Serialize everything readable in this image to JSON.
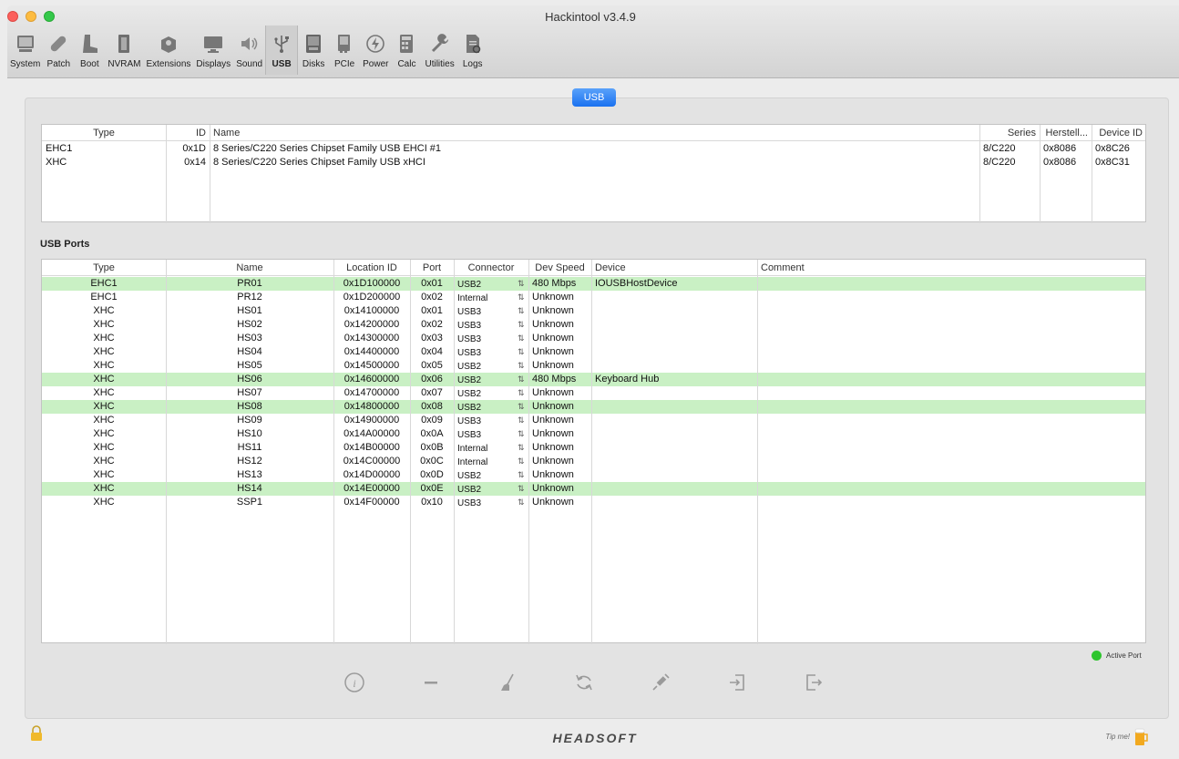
{
  "window": {
    "title": "Hackintool v3.4.9"
  },
  "toolbar": [
    {
      "label": "System",
      "icon": "system-icon"
    },
    {
      "label": "Patch",
      "icon": "patch-icon"
    },
    {
      "label": "Boot",
      "icon": "boot-icon"
    },
    {
      "label": "NVRAM",
      "icon": "nvram-icon"
    },
    {
      "label": "Extensions",
      "icon": "extensions-icon"
    },
    {
      "label": "Displays",
      "icon": "displays-icon"
    },
    {
      "label": "Sound",
      "icon": "sound-icon"
    },
    {
      "label": "USB",
      "icon": "usb-icon",
      "active": true
    },
    {
      "label": "Disks",
      "icon": "disks-icon"
    },
    {
      "label": "PCIe",
      "icon": "pcie-icon"
    },
    {
      "label": "Power",
      "icon": "power-icon"
    },
    {
      "label": "Calc",
      "icon": "calc-icon"
    },
    {
      "label": "Utilities",
      "icon": "utilities-icon"
    },
    {
      "label": "Logs",
      "icon": "logs-icon"
    }
  ],
  "tab": {
    "label": "USB"
  },
  "controllers": {
    "headers": {
      "type": "Type",
      "id": "ID",
      "name": "Name",
      "series": "Series",
      "vendor": "Herstell...",
      "device": "Device ID"
    },
    "rows": [
      {
        "type": "EHC1",
        "id": "0x1D",
        "name": "8 Series/C220 Series Chipset Family USB EHCI #1",
        "series": "8/C220",
        "vendor": "0x8086",
        "device": "0x8C26"
      },
      {
        "type": "XHC",
        "id": "0x14",
        "name": "8 Series/C220 Series Chipset Family USB xHCI",
        "series": "8/C220",
        "vendor": "0x8086",
        "device": "0x8C31"
      }
    ]
  },
  "ports": {
    "title": "USB Ports",
    "headers": {
      "type": "Type",
      "name": "Name",
      "location": "Location ID",
      "port": "Port",
      "connector": "Connector",
      "speed": "Dev Speed",
      "device": "Device",
      "comment": "Comment"
    },
    "rows": [
      {
        "type": "EHC1",
        "name": "PR01",
        "location": "0x1D100000",
        "port": "0x01",
        "connector": "USB2",
        "speed": "480 Mbps",
        "device": "IOUSBHostDevice",
        "comment": "",
        "active": true
      },
      {
        "type": "EHC1",
        "name": "PR12",
        "location": "0x1D200000",
        "port": "0x02",
        "connector": "Internal",
        "speed": "Unknown",
        "device": "",
        "comment": "",
        "active": false
      },
      {
        "type": "XHC",
        "name": "HS01",
        "location": "0x14100000",
        "port": "0x01",
        "connector": "USB3",
        "speed": "Unknown",
        "device": "",
        "comment": "",
        "active": false
      },
      {
        "type": "XHC",
        "name": "HS02",
        "location": "0x14200000",
        "port": "0x02",
        "connector": "USB3",
        "speed": "Unknown",
        "device": "",
        "comment": "",
        "active": false
      },
      {
        "type": "XHC",
        "name": "HS03",
        "location": "0x14300000",
        "port": "0x03",
        "connector": "USB3",
        "speed": "Unknown",
        "device": "",
        "comment": "",
        "active": false
      },
      {
        "type": "XHC",
        "name": "HS04",
        "location": "0x14400000",
        "port": "0x04",
        "connector": "USB3",
        "speed": "Unknown",
        "device": "",
        "comment": "",
        "active": false
      },
      {
        "type": "XHC",
        "name": "HS05",
        "location": "0x14500000",
        "port": "0x05",
        "connector": "USB2",
        "speed": "Unknown",
        "device": "",
        "comment": "",
        "active": false
      },
      {
        "type": "XHC",
        "name": "HS06",
        "location": "0x14600000",
        "port": "0x06",
        "connector": "USB2",
        "speed": "480 Mbps",
        "device": "Keyboard Hub",
        "comment": "",
        "active": true
      },
      {
        "type": "XHC",
        "name": "HS07",
        "location": "0x14700000",
        "port": "0x07",
        "connector": "USB2",
        "speed": "Unknown",
        "device": "",
        "comment": "",
        "active": false
      },
      {
        "type": "XHC",
        "name": "HS08",
        "location": "0x14800000",
        "port": "0x08",
        "connector": "USB2",
        "speed": "Unknown",
        "device": "",
        "comment": "",
        "active": true
      },
      {
        "type": "XHC",
        "name": "HS09",
        "location": "0x14900000",
        "port": "0x09",
        "connector": "USB3",
        "speed": "Unknown",
        "device": "",
        "comment": "",
        "active": false
      },
      {
        "type": "XHC",
        "name": "HS10",
        "location": "0x14A00000",
        "port": "0x0A",
        "connector": "USB3",
        "speed": "Unknown",
        "device": "",
        "comment": "",
        "active": false
      },
      {
        "type": "XHC",
        "name": "HS11",
        "location": "0x14B00000",
        "port": "0x0B",
        "connector": "Internal",
        "speed": "Unknown",
        "device": "",
        "comment": "",
        "active": false
      },
      {
        "type": "XHC",
        "name": "HS12",
        "location": "0x14C00000",
        "port": "0x0C",
        "connector": "Internal",
        "speed": "Unknown",
        "device": "",
        "comment": "",
        "active": false
      },
      {
        "type": "XHC",
        "name": "HS13",
        "location": "0x14D00000",
        "port": "0x0D",
        "connector": "USB2",
        "speed": "Unknown",
        "device": "",
        "comment": "",
        "active": false
      },
      {
        "type": "XHC",
        "name": "HS14",
        "location": "0x14E00000",
        "port": "0x0E",
        "connector": "USB2",
        "speed": "Unknown",
        "device": "",
        "comment": "",
        "active": true
      },
      {
        "type": "XHC",
        "name": "SSP1",
        "location": "0x14F00000",
        "port": "0x10",
        "connector": "USB3",
        "speed": "Unknown",
        "device": "",
        "comment": "",
        "active": false
      }
    ]
  },
  "legend": {
    "label": "Active Port",
    "color": "#2ec52e"
  },
  "active_row_color": "#c9f0c4",
  "bottom_buttons": [
    {
      "name": "info-button",
      "icon": "info-icon"
    },
    {
      "name": "remove-button",
      "icon": "minus-icon"
    },
    {
      "name": "clear-button",
      "icon": "broom-icon"
    },
    {
      "name": "refresh-button",
      "icon": "refresh-icon"
    },
    {
      "name": "inject-button",
      "icon": "syringe-icon"
    },
    {
      "name": "import-button",
      "icon": "import-icon"
    },
    {
      "name": "export-button",
      "icon": "export-icon"
    }
  ],
  "footer": {
    "brand": "HEADSOFT",
    "tip": "Tip me!"
  }
}
